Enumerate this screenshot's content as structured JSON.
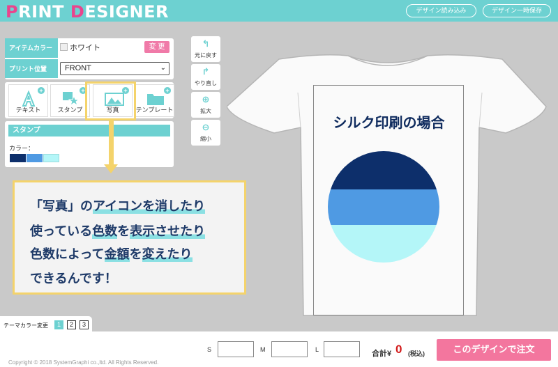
{
  "header": {
    "logo_letter_p": "P",
    "logo_rint": "RINT ",
    "logo_letter_d": "D",
    "logo_esigner": "ESIGNER",
    "load_design_label": "デザイン読み込み",
    "save_design_label": "デザイン一時保存",
    "brand_color": "#6dd1d1",
    "accent_color": "#e9458d"
  },
  "options": {
    "item_color_label": "アイテムカラー",
    "item_color_value": "ホワイト",
    "change_button": "変 更",
    "print_position_label": "プリント位置",
    "print_position_value": "FRONT"
  },
  "tools": [
    {
      "label": "テキスト",
      "icon": "text-icon"
    },
    {
      "label": "スタンプ",
      "icon": "stamp-icon"
    },
    {
      "label": "写真",
      "icon": "photo-icon"
    },
    {
      "label": "テンプレート",
      "icon": "folder-icon"
    }
  ],
  "stamp_panel": {
    "title": "スタンプ",
    "color_label": "カラー：",
    "colors": [
      "#0d2f6b",
      "#4f9ae3",
      "#b4f6f8"
    ]
  },
  "side_tools": [
    {
      "label": "元に戻す",
      "icon": "undo-icon"
    },
    {
      "label": "やり直し",
      "icon": "redo-icon"
    },
    {
      "label": "拡大",
      "icon": "zoom-in-icon"
    },
    {
      "label": "縮小",
      "icon": "zoom-out-icon"
    }
  ],
  "callout": {
    "line1_a": "「写真」の",
    "line1_b": "アイコンを消したり",
    "line2_a": "使っている",
    "line2_b": "色数",
    "line2_c": "を",
    "line2_d": "表示させたり",
    "line3_a": "色数によって",
    "line3_b": "金額",
    "line3_c": "を",
    "line3_d": "変えたり",
    "line4": "できるんです！"
  },
  "canvas": {
    "print_text": "シルク印刷の場合",
    "circle_colors": [
      "#0d2f6b",
      "#4f9ae3",
      "#b4f6f8"
    ]
  },
  "theme": {
    "label": "テーマカラー変更",
    "options": [
      "1",
      "2",
      "3"
    ],
    "active": "1"
  },
  "footer": {
    "size_s": "S",
    "size_m": "M",
    "size_l": "L",
    "total_label": "合計",
    "total_currency": "¥",
    "total_value": "0",
    "tax_label": "(税込)",
    "order_button": "このデザインで注文",
    "copyright": "Copyright © 2018 SystemGraphi co.,ltd. All Rights Reserved."
  }
}
